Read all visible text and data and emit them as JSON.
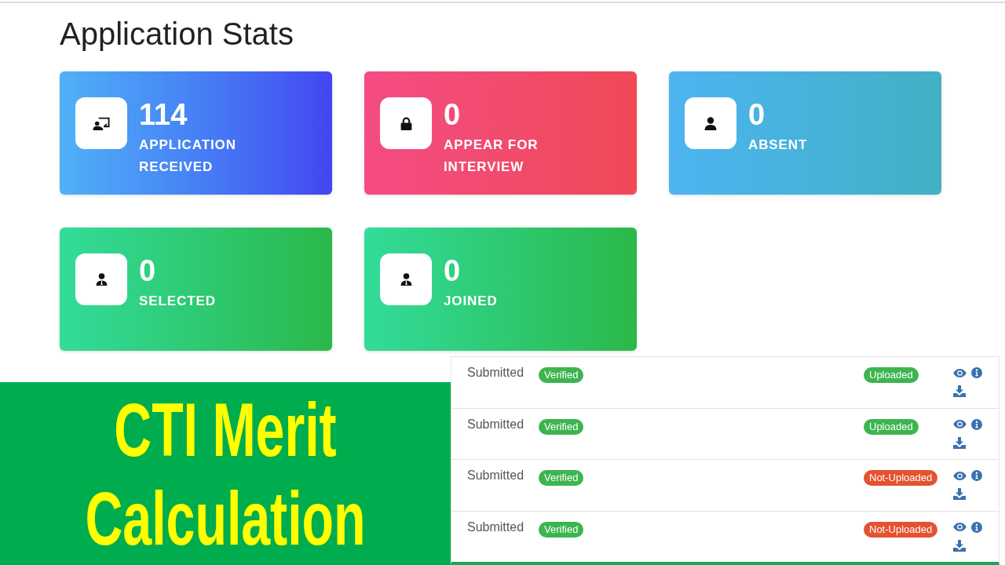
{
  "page": {
    "title": "Application Stats"
  },
  "stat_cards": [
    {
      "kind": "received",
      "value": "114",
      "label": "APPLICATION RECEIVED"
    },
    {
      "kind": "interview",
      "value": "0",
      "label": "APPEAR FOR INTERVIEW"
    },
    {
      "kind": "absent",
      "value": "0",
      "label": "ABSENT"
    },
    {
      "kind": "selected",
      "value": "0",
      "label": "SELECTED"
    },
    {
      "kind": "joined",
      "value": "0",
      "label": "JOINED"
    }
  ],
  "banner": {
    "title": "CTI Merit Calculation"
  },
  "table": {
    "rows": [
      {
        "column_1": "Submitted",
        "column_2": {
          "label": "Verified",
          "color": "#3db54f"
        },
        "column_3": {
          "label": "Uploaded",
          "color": "#3db54f"
        }
      },
      {
        "column_1": "Submitted",
        "column_2": {
          "label": "Verified",
          "color": "#3db54f"
        },
        "column_3": {
          "label": "Uploaded",
          "color": "#3db54f"
        }
      },
      {
        "column_1": "Submitted",
        "column_2": {
          "label": "Verified",
          "color": "#3db54f"
        },
        "column_3": {
          "label": "Not-Uploaded",
          "color": "#e4522f"
        }
      },
      {
        "column_1": "Submitted",
        "column_2": {
          "label": "Verified",
          "color": "#3db54f"
        },
        "column_3": {
          "label": "Not-Uploaded",
          "color": "#e4522f"
        }
      }
    ]
  }
}
